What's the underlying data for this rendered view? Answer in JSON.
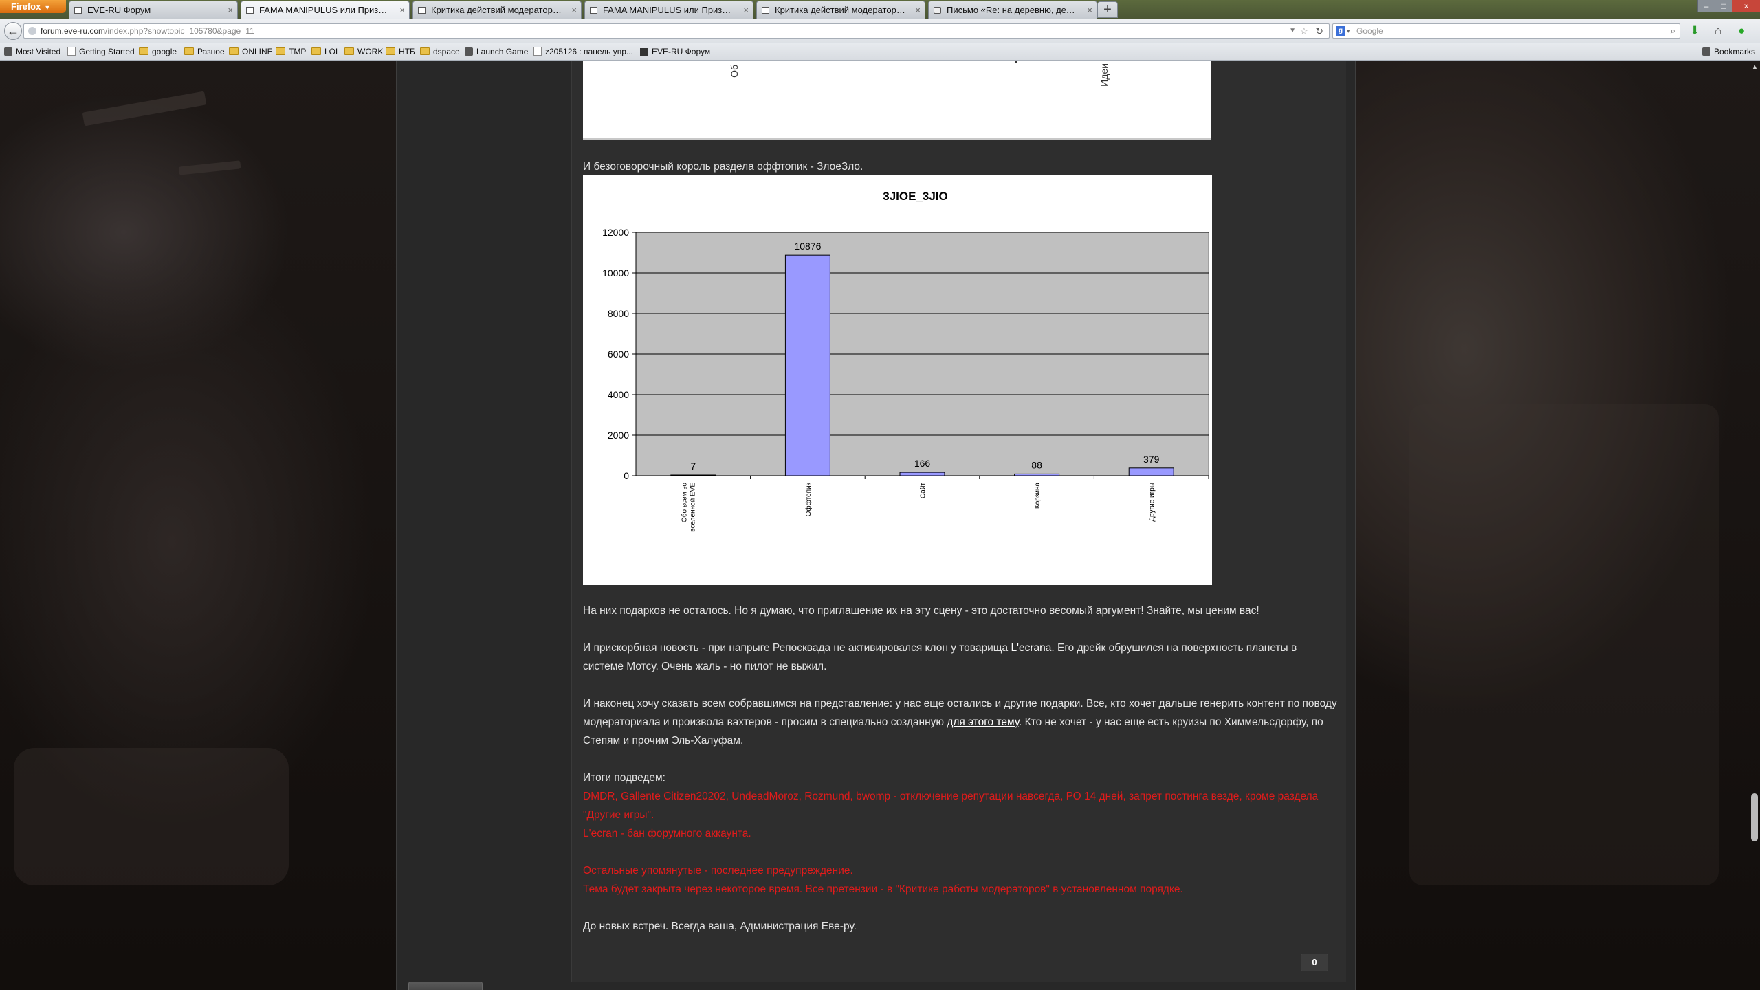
{
  "browser": {
    "app_button": "Firefox",
    "tabs": [
      {
        "label": "EVE-RU Форум",
        "icon": "page-icon"
      },
      {
        "label": "FAMA MANIPULUS или Призрачны...",
        "icon": "page-icon"
      },
      {
        "label": "Критика действий модераторов - Ст...",
        "icon": "page-icon"
      },
      {
        "label": "FAMA MANIPULUS или Призрачны...",
        "icon": "page-icon"
      },
      {
        "label": "Критика действий модераторов - Ст...",
        "icon": "page-icon"
      },
      {
        "label": "Письмо «Re: на деревню, дедушке» ...",
        "icon": "mail-icon"
      }
    ],
    "active_tab": 1,
    "url_domain": "forum.eve-ru.com",
    "url_path": "/index.php?showtopic=105780&page=11",
    "search_placeholder": "Google",
    "bookmarks": [
      {
        "label": "Most Visited",
        "icon": "gear-icon"
      },
      {
        "label": "Getting Started",
        "icon": "page-icon"
      },
      {
        "label": "google",
        "icon": "folder-icon"
      },
      {
        "label": "Разное",
        "icon": "folder-icon"
      },
      {
        "label": "ONLINE",
        "icon": "folder-icon"
      },
      {
        "label": "TMP",
        "icon": "folder-icon"
      },
      {
        "label": "LOL",
        "icon": "folder-icon"
      },
      {
        "label": "WORK",
        "icon": "folder-icon"
      },
      {
        "label": "НТБ",
        "icon": "folder-icon"
      },
      {
        "label": "dspace",
        "icon": "folder-icon"
      },
      {
        "label": "Launch Game",
        "icon": "launch-icon"
      },
      {
        "label": "z205126 : панель упр...",
        "icon": "page-icon"
      },
      {
        "label": "EVE-RU Форум",
        "icon": "eve-icon"
      }
    ],
    "bookmarks_menu": "Bookmarks"
  },
  "post": {
    "prev_chart_label_left": "Об",
    "prev_chart_label_right": "Идеи",
    "intro": "И безоговорочный король раздела оффтопик - ЗлоеЗло.",
    "p1": "На них подарков не осталось. Но я думаю, что приглашение их на эту сцену - это достаточно весомый аргумент! Знайте, мы ценим вас!",
    "p2_a": "И прискорбная новость - при напрыге Репосквада не активировался клон у товарища ",
    "p2_link": "L'ecran",
    "p2_b": "а. Его дрейк обрушился на поверхность планеты в системе Мотсу. Очень жаль - но пилот не выжил.",
    "p3_a": "И наконец хочу сказать всем собравшимся на представление: у нас еще остались и другие подарки. Все, кто хочет дальше генерить контент по поводу модераториала и произвола вахтеров - просим в специально созданную ",
    "p3_link": "для этого тему",
    "p3_b": ". Кто не хочет - у нас еще есть круизы по Химмельсдорфу, по Степям и прочим Эль-Халуфам.",
    "summary_title": "Итоги подведем:",
    "red_1": "DMDR, Gallente Citizen20202, UndeadMoroz, Rozmund, bwomp - отключение репутации навсегда, РО 14 дней, запрет постинга везде, кроме раздела \"Другие игры\".",
    "red_2": "L'ecran - бан форумного аккаунта.",
    "red_3": "Остальные упомянутые - последнее предупреждение.",
    "red_4": "Тема будет закрыта через некоторое время. Все претензии - в \"Критике работы модераторов\" в установленном порядке.",
    "signoff": "До новых встреч. Всегда ваша, Администрация Еве-ру.",
    "reputation": "0"
  },
  "chart_data": {
    "type": "bar",
    "title": "3JIOE_3JIO",
    "categories": [
      "Обо всем во вселенной EVE",
      "Оффтопик",
      "Сайт",
      "Корзина",
      "Другие игры"
    ],
    "category_lines": [
      [
        "Обо всем во",
        "вселенной EVE"
      ],
      [
        "Оффтопик"
      ],
      [
        "Сайт"
      ],
      [
        "Корзина"
      ],
      [
        "Другие игры"
      ]
    ],
    "values": [
      7,
      10876,
      166,
      88,
      379
    ],
    "ylim": [
      0,
      12000
    ],
    "yticks": [
      0,
      2000,
      4000,
      6000,
      8000,
      10000,
      12000
    ],
    "grid": true,
    "bar_color": "#9999ff",
    "plot_bg": "#c0c0c0"
  }
}
